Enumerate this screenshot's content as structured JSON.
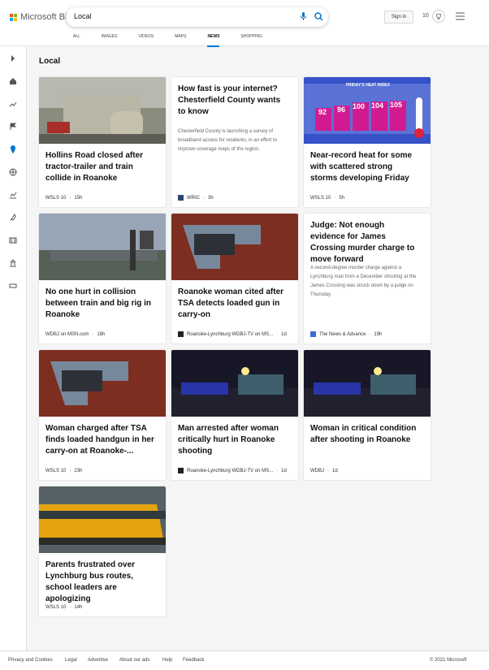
{
  "brand": {
    "name": "Microsoft Bing"
  },
  "search": {
    "value": "Local"
  },
  "header": {
    "sign_in": "Sign in",
    "rewards": "10"
  },
  "scopes": [
    "ALL",
    "IMAGES",
    "VIDEOS",
    "MAPS",
    "NEWS",
    "SHOPPING"
  ],
  "page": {
    "title": "Local"
  },
  "cards": [
    {
      "title": "Hollins Road closed after tractor-trailer and train collide in Roanoke",
      "source": "WSLS 10",
      "time": "15h"
    },
    {
      "title": "How fast is your internet? Chesterfield County wants to know",
      "snippet": "Chesterfield County is launching a survey of broadband access for residents, in an effort to improve coverage maps of the region.",
      "source": "WRIC",
      "time": "3h"
    },
    {
      "title": "Near-record heat for some with scattered strong storms developing Friday",
      "source": "WSLS 10",
      "time": "5h"
    },
    {
      "title": "No one hurt in collision between train and big rig in Roanoke",
      "source": "WDBJ on MSN.com",
      "time": "18h"
    },
    {
      "title": "Roanoke woman cited after TSA detects loaded gun in carry-on",
      "source": "Roanoke-Lynchburg WDBJ-TV on MS...",
      "time": "1d"
    },
    {
      "title": "Judge: Not enough evidence for James Crossing murder charge to move forward",
      "snippet": "A second-degree murder charge against a Lynchburg man from a December shooting at the James Crossing was struck down by a judge on Thursday.",
      "source": "The News & Advance",
      "time": "19h"
    },
    {
      "title": "Woman charged after TSA finds loaded handgun in her carry-on at Roanoke-...",
      "source": "WSLS 10",
      "time": "23h"
    },
    {
      "title": "Man arrested after woman critically hurt in Roanoke shooting",
      "source": "Roanoke-Lynchburg WDBJ-TV on MS...",
      "time": "1d"
    },
    {
      "title": "Woman in critical condition after shooting in Roanoke",
      "source": "WDBJ",
      "time": "1d"
    },
    {
      "title": "Parents frustrated over Lynchburg bus routes, school leaders are apologizing",
      "source": "WSLS 10",
      "time": "14h"
    }
  ],
  "heat_graphic": {
    "label": "FRIDAY'S HEAT INDEX",
    "values": [
      "92",
      "96",
      "100",
      "104",
      "105"
    ],
    "stations": [
      "The NRV",
      "Highlands",
      "Roanoke",
      "Lynchburg",
      "Southside"
    ]
  },
  "footer": {
    "privacy": "Privacy and Cookies",
    "legal": "Legal",
    "advertise": "Advertise",
    "about_ads": "About our ads",
    "help": "Help",
    "feedback": "Feedback",
    "copyright": "© 2021 Microsoft"
  },
  "colors": {
    "accent": "#0077cc",
    "heat_magenta": "#d21b91"
  }
}
